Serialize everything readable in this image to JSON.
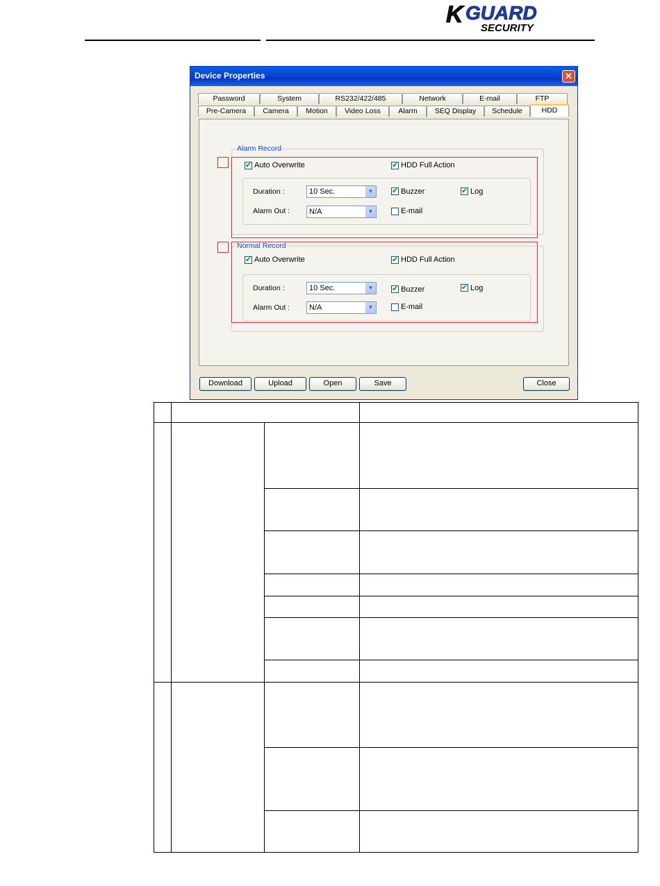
{
  "header": {
    "logo_main": "KGUARD",
    "logo_sub": "SECURITY"
  },
  "dialog": {
    "title": "Device Properties",
    "close_glyph": "✕",
    "tabs_row1": [
      "Password",
      "System",
      "RS232/422/485",
      "Network",
      "E-mail",
      "FTP"
    ],
    "tabs_row2": [
      "Pre-Camera",
      "Camera",
      "Motion",
      "Video Loss",
      "Alarm",
      "SEQ Display",
      "Schedule",
      "HDD"
    ],
    "active_tab": "HDD",
    "alarm_record": {
      "legend": "Alarm Record",
      "auto_overwrite": {
        "label": "Auto Overwrite",
        "checked": true
      },
      "hdd_full_action": {
        "label": "HDD Full Action",
        "checked": true
      },
      "duration_label": "Duration :",
      "duration_value": "10 Sec.",
      "alarm_out_label": "Alarm Out :",
      "alarm_out_value": "N/A",
      "buzzer": {
        "label": "Buzzer",
        "checked": true
      },
      "log": {
        "label": "Log",
        "checked": true
      },
      "email": {
        "label": "E-mail",
        "checked": false
      }
    },
    "normal_record": {
      "legend": "Normal Record",
      "auto_overwrite": {
        "label": "Auto Overwrite",
        "checked": true
      },
      "hdd_full_action": {
        "label": "HDD Full Action",
        "checked": true
      },
      "duration_label": "Duration :",
      "duration_value": "10 Sec.",
      "alarm_out_label": "Alarm Out :",
      "alarm_out_value": "N/A",
      "buzzer": {
        "label": "Buzzer",
        "checked": true
      },
      "log": {
        "label": "Log",
        "checked": true
      },
      "email": {
        "label": "E-mail",
        "checked": false
      }
    },
    "buttons": {
      "download": "Download",
      "upload": "Upload",
      "open": "Open",
      "save": "Save",
      "close": "Close"
    }
  },
  "checkmark_glyph": "✔",
  "dropdown_glyph": "▼",
  "colors": {
    "title_bar": "#0347d3",
    "highlight_box": "#e32636",
    "legend_text": "#0046d5",
    "active_tab_accent": "#ffc83c"
  }
}
